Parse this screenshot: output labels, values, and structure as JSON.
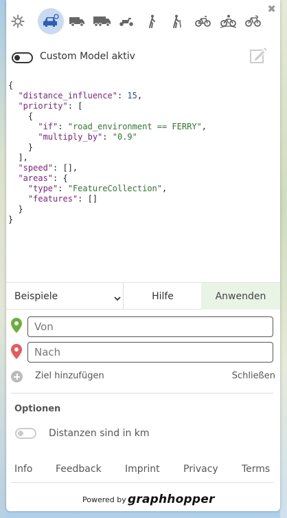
{
  "toolbar": {
    "icons": [
      "settings-gear-icon",
      "car-icon",
      "small-truck-icon",
      "truck-icon",
      "scooter-icon",
      "foot-icon",
      "hike-icon",
      "bike-icon",
      "mtb-icon",
      "racingbike-icon"
    ],
    "close_label": "✖"
  },
  "custom_model": {
    "toggle_label": "Custom Model aktiv",
    "enabled": true
  },
  "code_lines": [
    "{",
    "  \"distance_influence\": 15,",
    "  \"priority\": [",
    "    {",
    "      \"if\": \"road_environment == FERRY\",",
    "      \"multiply_by\": \"0.9\"",
    "    }",
    "  ],",
    "  \"speed\": [],",
    "  \"areas\": {",
    "    \"type\": \"FeatureCollection\",",
    "    \"features\": []",
    "  }",
    "}"
  ],
  "actions": {
    "examples_select": "Beispiele",
    "help": "Hilfe",
    "apply": "Anwenden"
  },
  "route": {
    "from_placeholder": "Von",
    "to_placeholder": "Nach",
    "add_destination": "Ziel hinzufügen",
    "close": "Schließen"
  },
  "options": {
    "title": "Optionen",
    "distance_km_label": "Distanzen sind in km",
    "distance_km_enabled": false
  },
  "footer": {
    "links": [
      "Info",
      "Feedback",
      "Imprint",
      "Privacy",
      "Terms"
    ],
    "powered_by": "Powered by",
    "logo_text": "GraphHopper"
  },
  "colors": {
    "accent_blue": "#3b6fc4",
    "apply_bg": "#e9f3e6",
    "pin_green": "#6aae3c",
    "pin_red": "#e85a5a"
  }
}
